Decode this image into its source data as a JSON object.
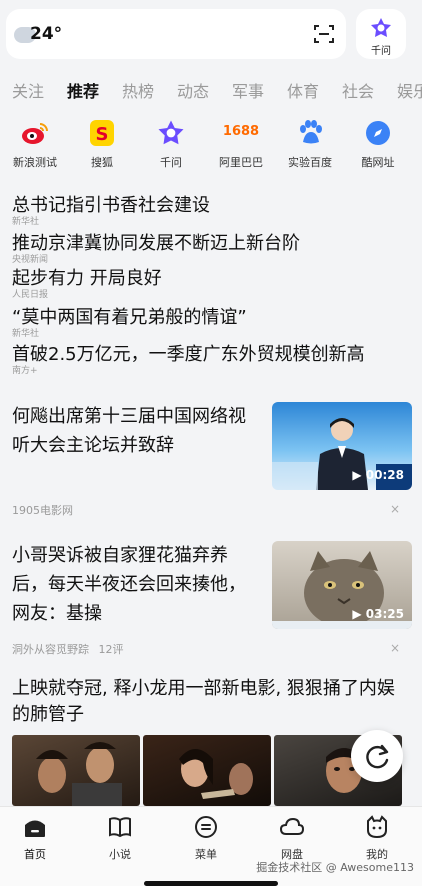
{
  "weather": {
    "temperature": "24°"
  },
  "qianwen": {
    "label": "千问"
  },
  "tabs": [
    "关注",
    "推荐",
    "热榜",
    "动态",
    "军事",
    "体育",
    "社会",
    "娱乐"
  ],
  "shortcuts": [
    {
      "label": "新浪测试",
      "icon": "weibo-icon"
    },
    {
      "label": "搜狐",
      "icon": "sohu-icon"
    },
    {
      "label": "千问",
      "icon": "qianwen-icon"
    },
    {
      "label": "阿里巴巴",
      "icon": "alibaba-1688-icon",
      "icon_text": "1688"
    },
    {
      "label": "实验百度",
      "icon": "baidu-paw-icon"
    },
    {
      "label": "酷网址",
      "icon": "compass-icon"
    }
  ],
  "headlines": [
    {
      "title": "总书记指引书香社会建设",
      "source": "新华社"
    },
    {
      "title": "推动京津冀协同发展不断迈上新台阶",
      "source": "央视新闻"
    },
    {
      "title": "起步有力 开局良好",
      "source": "人民日报"
    },
    {
      "title": "“莫中两国有着兄弟般的情谊”",
      "source": "新华社"
    },
    {
      "title": "首破2.5万亿元，一季度广东外贸规模创新高",
      "source": "南方+"
    }
  ],
  "cards": [
    {
      "title": "何飚出席第十三届中国网络视听大会主论坛并致辞",
      "duration": "00:28",
      "source": "1905电影网",
      "comments": ""
    },
    {
      "title": "小哥哭诉被自家狸花猫弃养后，每天半夜还会回来揍他，网友：基操",
      "duration": "03:25",
      "source": "洞外从容觅野踪",
      "comments": "12评"
    }
  ],
  "photo_post": {
    "title": "上映就夺冠, 释小龙用一部新电影, 狠狠捅了内娱的肺管子"
  },
  "close_glyph": "×",
  "nav": [
    {
      "label": "首页",
      "icon": "home-icon"
    },
    {
      "label": "小说",
      "icon": "book-icon"
    },
    {
      "label": "菜单",
      "icon": "menu-icon"
    },
    {
      "label": "网盘",
      "icon": "cloud-icon"
    },
    {
      "label": "我的",
      "icon": "profile-icon"
    }
  ],
  "watermark": "掘金技术社区 @ Awesome113",
  "colors": {
    "accent": "#6b4dff",
    "link_blue": "#3b82f6"
  }
}
